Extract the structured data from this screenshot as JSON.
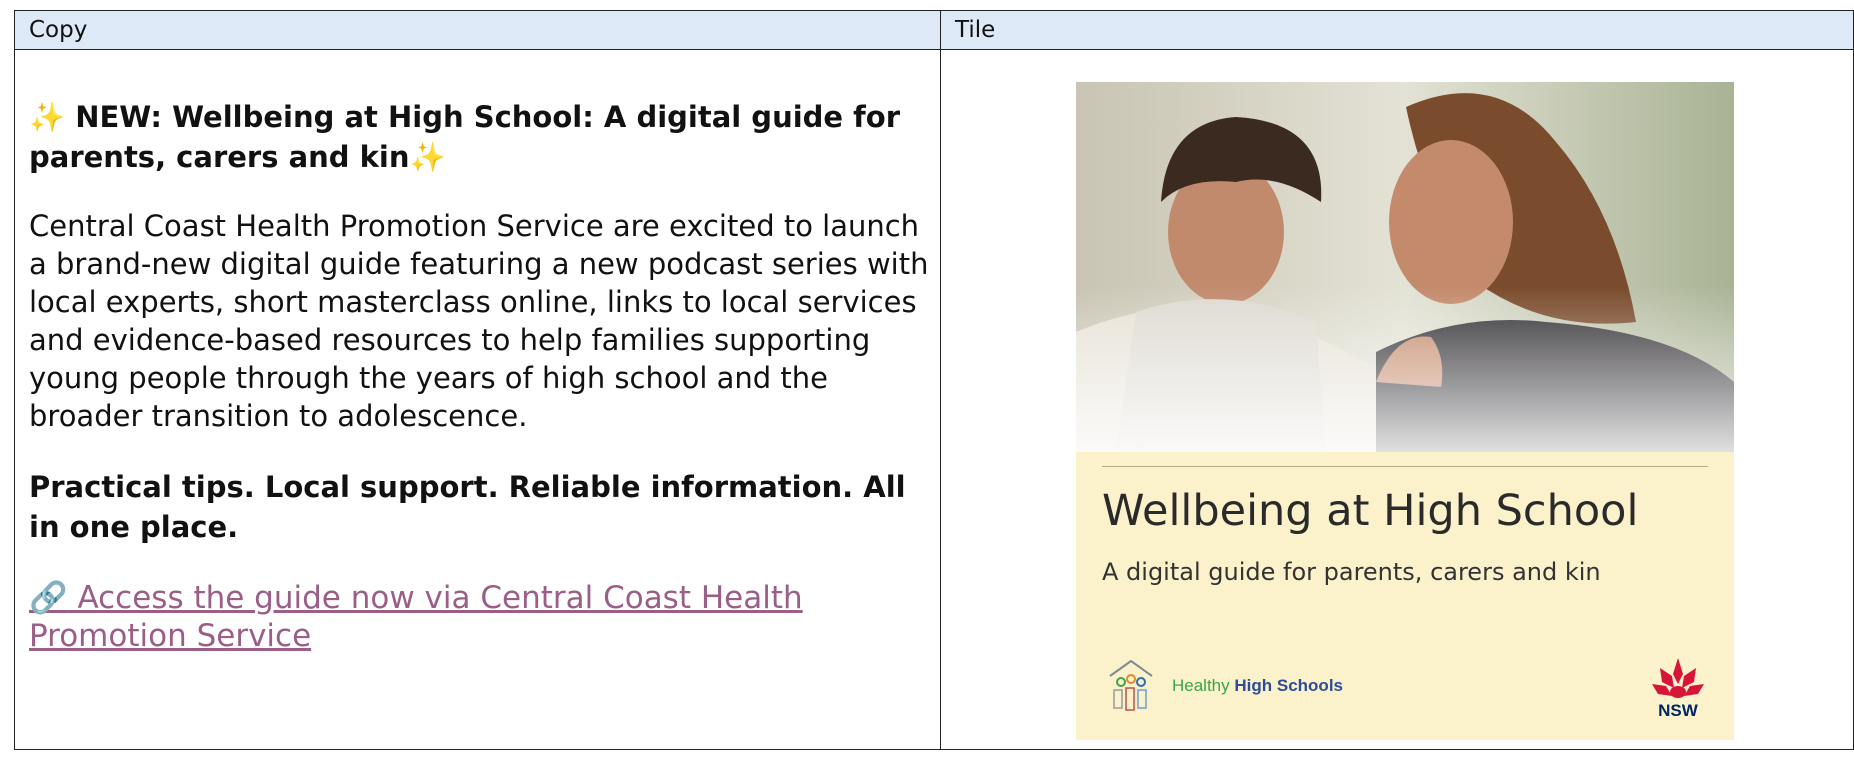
{
  "table": {
    "header": {
      "copy": "Copy",
      "tile": "Tile"
    }
  },
  "copy": {
    "headline_sparkle_left": "✨",
    "headline": "NEW: Wellbeing at High School: A digital guide for parents, carers and kin",
    "headline_sparkle_right": "✨",
    "paragraph": "Central Coast Health Promotion Service are excited to launch a brand-new digital guide featuring a new podcast series with local experts, short masterclass online, links to local services and evidence-based resources to help families supporting young people through the years of high school and the broader transition to adolescence.",
    "tagline": "Practical tips. Local support. Reliable information. All in one place.",
    "link_icon": "🔗",
    "link_text": "Access the guide now via Central Coast Health Promotion Service"
  },
  "tile": {
    "title": "Wellbeing at High School",
    "subtitle": "A digital guide for parents, carers and kin",
    "logo_left_healthy": "Healthy",
    "logo_left_high_schools": "High Schools",
    "logo_right_text": "NSW"
  },
  "colors": {
    "header_bg": "#dde9f7",
    "link": "#9b5f87",
    "tile_bg": "#fbf1ca",
    "nsw_red": "#d7153a",
    "nsw_blue": "#002664"
  },
  "icons": [
    "sparkles-icon",
    "link-icon",
    "healthy-high-schools-logo",
    "nsw-waratah-logo"
  ]
}
